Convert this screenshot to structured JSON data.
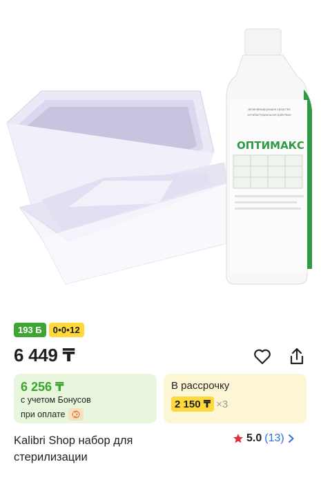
{
  "badges": {
    "bonus": "193 Б",
    "installment": "0•0•12"
  },
  "price": "6 449 ₸",
  "bonus_card": {
    "price": "6 256 ₸",
    "note_line1": "с учетом Бонусов",
    "note_line2": "при оплате"
  },
  "installment_card": {
    "label": "В рассрочку",
    "amount": "2 150 ₸",
    "multiplier": "×3"
  },
  "product": {
    "title_line1": "Kalibri Shop набор для",
    "title_line2": "стерилизации",
    "bottle_brand": "ОПТИМАКС"
  },
  "rating": {
    "score": "5.0",
    "count": "(13)"
  },
  "colors": {
    "bonus_green": "#3fa434",
    "installment_yellow": "#ffd83b",
    "star_red": "#e0313a",
    "link_blue": "#2a6fdb"
  },
  "icons": [
    "heart-icon",
    "share-icon",
    "star-icon",
    "chevron-right-icon",
    "kaspi-pay-icon"
  ]
}
